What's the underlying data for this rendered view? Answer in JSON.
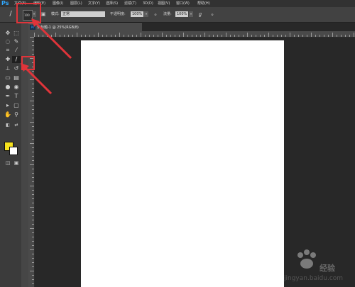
{
  "app": {
    "logo": "Ps"
  },
  "menu": [
    "文件(F)",
    "编辑(E)",
    "图像(I)",
    "图层(L)",
    "文字(Y)",
    "选择(S)",
    "滤镜(T)",
    "3D(D)",
    "视图(V)",
    "窗口(W)",
    "帮助(H)"
  ],
  "options": {
    "brush_size": "100",
    "mode_label": "模式:",
    "mode_value": "正常",
    "opacity_label": "不透明度:",
    "opacity_value": "100%",
    "flow_label": "流量:",
    "flow_value": "100%"
  },
  "document": {
    "tab_label": "未标题-1 @ 25%(RGB/8)"
  },
  "tools": [
    "move-icon",
    "marquee-icon",
    "lasso-icon",
    "quick-select-icon",
    "crop-icon",
    "eyedropper-icon",
    "healing-icon",
    "brush-icon",
    "stamp-icon",
    "history-brush-icon",
    "eraser-icon",
    "gradient-icon",
    "blur-icon",
    "dodge-icon",
    "pen-icon",
    "type-icon",
    "path-select-icon",
    "shape-icon",
    "hand-icon",
    "zoom-icon"
  ],
  "colors": {
    "foreground": "#f5e11d",
    "background": "#ffffff",
    "annotation": "#e0343a",
    "ps_blue": "#31a8ff"
  },
  "watermark": {
    "text": "经验",
    "url": "jingyan.baidu.com"
  }
}
